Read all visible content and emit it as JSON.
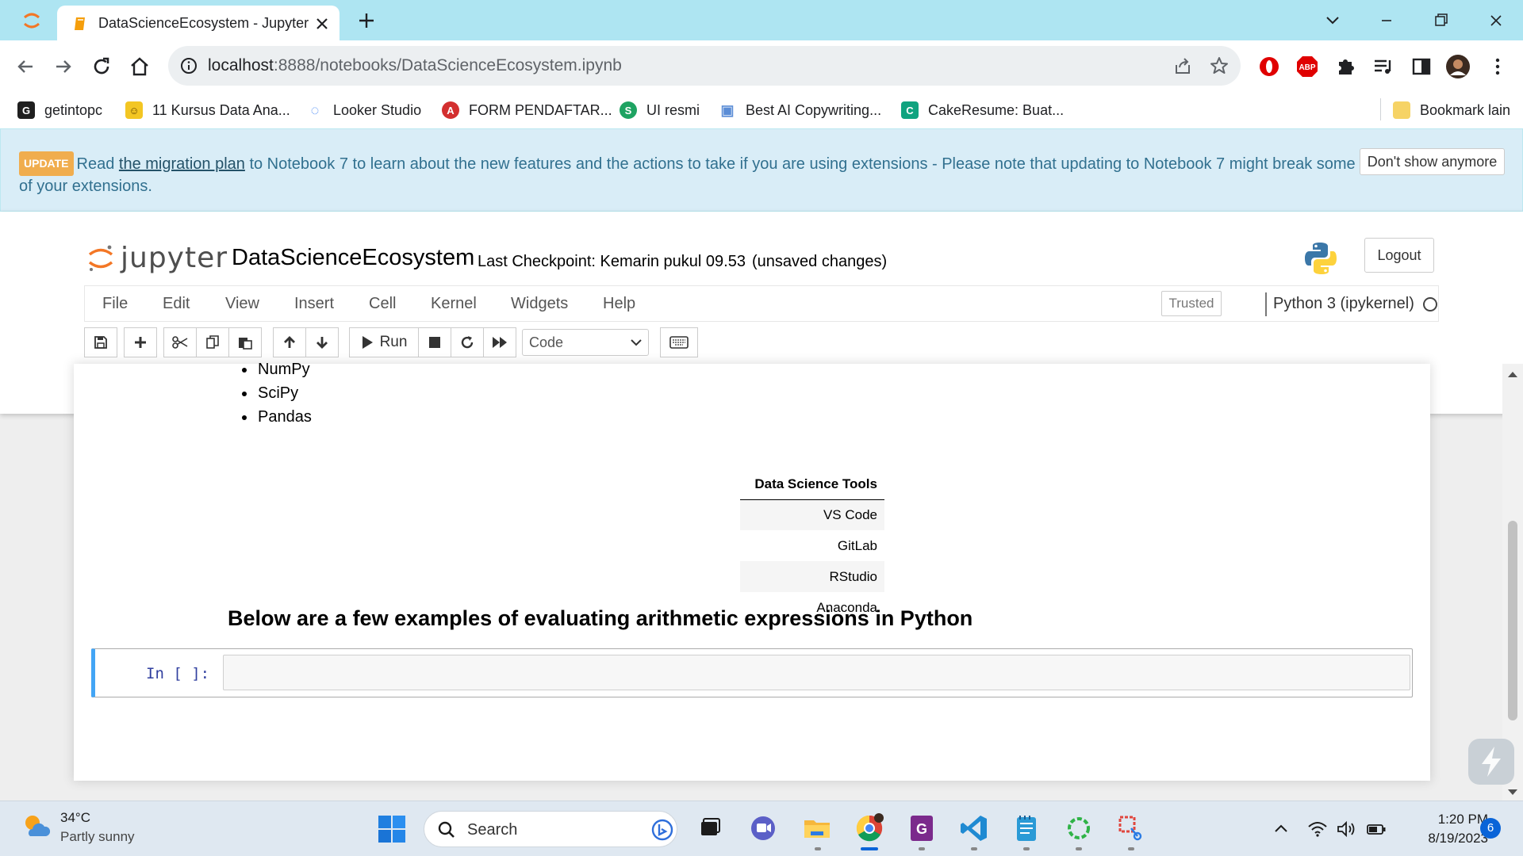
{
  "browser": {
    "tab_title": "DataScienceEcosystem - Jupyter",
    "url_host": "localhost",
    "url_rest": ":8888/notebooks/DataScienceEcosystem.ipynb",
    "bookmarks": [
      {
        "label": "getintopc",
        "icon": "G",
        "color": "#1f1f1f"
      },
      {
        "label": "11 Kursus Data Ana...",
        "icon": "☺",
        "color": "#f3c623"
      },
      {
        "label": "Looker Studio",
        "icon": "◌",
        "color": "#4285f4"
      },
      {
        "label": "FORM PENDAFTAR...",
        "icon": "A",
        "color": "#d32f2f"
      },
      {
        "label": "UI resmi",
        "icon": "S",
        "color": "#1ea362"
      },
      {
        "label": "Best AI Copywriting...",
        "icon": "▣",
        "color": "#5b8dd6"
      },
      {
        "label": "CakeResume: Buat...",
        "icon": "C",
        "color": "#10a37f"
      }
    ],
    "other_bookmarks": "Bookmark lain"
  },
  "banner": {
    "badge": "UPDATE",
    "text_before": "Read ",
    "link": "the migration plan",
    "text_after": " to Notebook 7 to learn about the new features and the actions to take if you are using extensions - Please note that updating to Notebook 7 might break some of your extensions.",
    "dismiss": "Don't show anymore"
  },
  "header": {
    "logo_text": "jupyter",
    "notebook_name": "DataScienceEcosystem",
    "checkpoint": "Last Checkpoint: Kemarin pukul 09.53",
    "autosave": "(unsaved changes)",
    "logout": "Logout"
  },
  "menu": {
    "items": [
      "File",
      "Edit",
      "View",
      "Insert",
      "Cell",
      "Kernel",
      "Widgets",
      "Help"
    ],
    "trusted": "Trusted",
    "kernel": "Python 3 (ipykernel)"
  },
  "toolbar": {
    "run_label": "Run",
    "cell_type": "Code"
  },
  "notebook": {
    "libraries": [
      "NumPy",
      "SciPy",
      "Pandas"
    ],
    "table": {
      "header": "Data Science Tools",
      "rows": [
        "VS Code",
        "GitLab",
        "RStudio",
        "Anaconda"
      ]
    },
    "heading": "Below are a few examples of evaluating arithmetic expressions in Python",
    "cell_prompt": "In [ ]:"
  },
  "taskbar": {
    "temperature": "34°C",
    "condition": "Partly sunny",
    "search": "Search",
    "time": "1:20 PM",
    "date": "8/19/2023",
    "notifications": "6"
  }
}
